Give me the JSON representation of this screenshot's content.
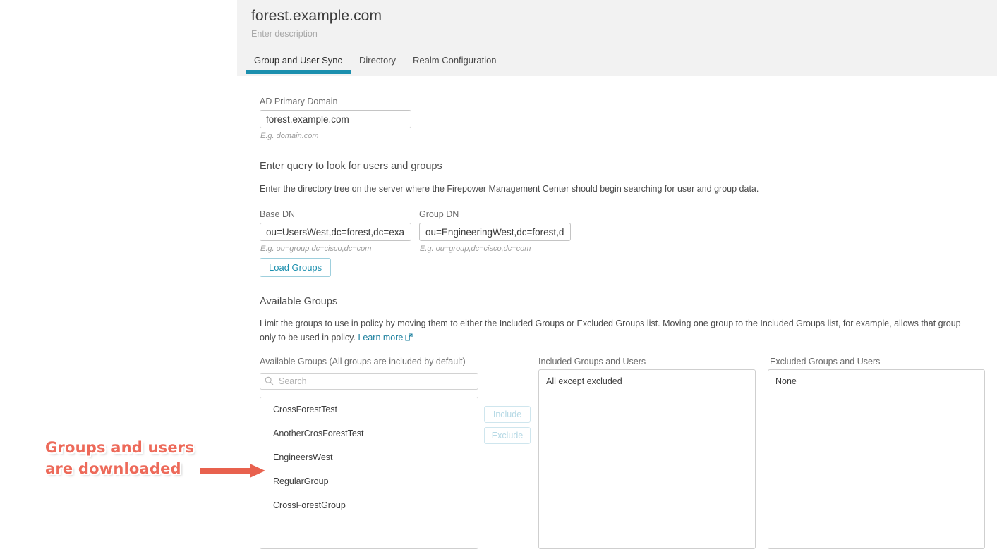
{
  "header": {
    "title": "forest.example.com",
    "description_placeholder": "Enter description",
    "tabs": [
      {
        "label": "Group and User Sync",
        "active": true
      },
      {
        "label": "Directory",
        "active": false
      },
      {
        "label": "Realm Configuration",
        "active": false
      }
    ]
  },
  "primary_domain": {
    "label": "AD Primary Domain",
    "value": "forest.example.com",
    "hint": "E.g. domain.com"
  },
  "query_section": {
    "heading": "Enter query to look for users and groups",
    "description": "Enter the directory tree on the server where the Firepower Management Center should begin searching for user and group data.",
    "base_dn": {
      "label": "Base DN",
      "value": "ou=UsersWest,dc=forest,dc=exa",
      "hint": "E.g. ou=group,dc=cisco,dc=com"
    },
    "group_dn": {
      "label": "Group DN",
      "value": "ou=EngineeringWest,dc=forest,d",
      "hint": "E.g. ou=group,dc=cisco,dc=com"
    },
    "load_groups_button": "Load Groups"
  },
  "available_section": {
    "heading": "Available Groups",
    "description_line1": "Limit the groups to use in policy by moving them to either the Included Groups or Excluded Groups list. Moving one group to the Included Groups list, for example, allows",
    "description_line2": "that group only to be used in policy.",
    "learn_more": "Learn more"
  },
  "available_groups": {
    "label": "Available Groups (All groups are included by default)",
    "search_placeholder": "Search",
    "search_value": "",
    "items": [
      "CrossForestTest",
      "AnotherCrosForestTest",
      "EngineersWest",
      "RegularGroup",
      "CrossForestGroup"
    ]
  },
  "transfer_buttons": {
    "include": "Include",
    "exclude": "Exclude"
  },
  "included": {
    "label": "Included Groups and Users",
    "value": "All except excluded"
  },
  "excluded": {
    "label": "Excluded Groups and Users",
    "value": "None"
  },
  "annotation": {
    "line1": "Groups and users",
    "line2": "are downloaded",
    "color": "#ed6a5a"
  },
  "colors": {
    "accent_teal": "#1b8fae",
    "link": "#1b7f9e",
    "header_bg": "#f2f2f2",
    "annotation_red": "#ed6a5a"
  }
}
